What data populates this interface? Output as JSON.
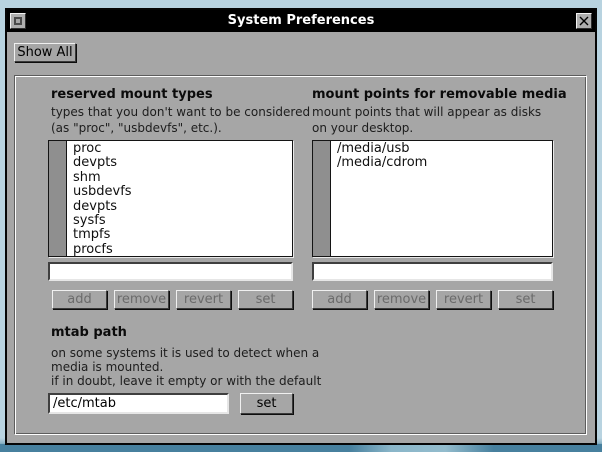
{
  "window": {
    "title": "System Preferences",
    "show_all_label": "Show All"
  },
  "panels": {
    "reserved": {
      "heading": "reserved mount types",
      "desc_lines": [
        "types that you don't want to be considered",
        "(as \"proc\", \"usbdevfs\", etc.)."
      ],
      "items": [
        "proc",
        "devpts",
        "shm",
        "usbdevfs",
        "devpts",
        "sysfs",
        "tmpfs",
        "procfs"
      ],
      "input_value": "",
      "buttons": [
        "add",
        "remove",
        "revert",
        "set"
      ]
    },
    "mount_points": {
      "heading": "mount points for removable media",
      "desc_lines": [
        "mount points that will appear as disks",
        "on your desktop."
      ],
      "items": [
        "/media/usb",
        "/media/cdrom"
      ],
      "input_value": "",
      "buttons": [
        "add",
        "remove",
        "revert",
        "set"
      ]
    },
    "mtab": {
      "heading": "mtab path",
      "desc_lines": [
        "on some systems it is used to detect when a",
        "media is mounted.",
        "if in doubt, leave it empty or with the default"
      ],
      "input_value": "/etc/mtab",
      "set_label": "set"
    }
  },
  "icons": {
    "titlebar_left": "window-menu-icon",
    "titlebar_right": "close-icon"
  },
  "colors": {
    "titlebar_bg": "#000000",
    "titlebar_text": "#ffffff",
    "window_bg": "#a6a6a6",
    "desktop_top": "#b8d3e0",
    "desktop_band": "#47809e",
    "desktop_band_light": "#8ab6c9",
    "list_bg": "#ffffff",
    "scroll_trough": "#8f8f8f",
    "disabled_text": "#6b6b6b"
  }
}
